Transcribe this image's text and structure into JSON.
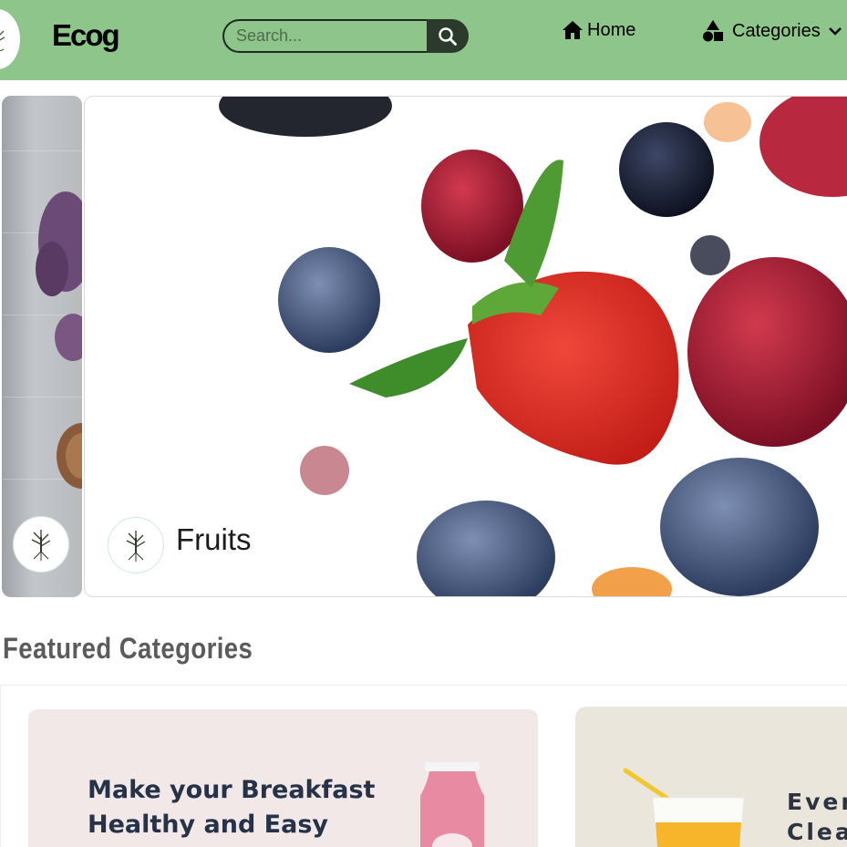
{
  "header": {
    "brand": "Ecog",
    "search": {
      "placeholder": "Search..."
    },
    "nav": {
      "home": "Home",
      "categories": "Categories"
    }
  },
  "hero": {
    "slides": [
      {
        "label": ""
      },
      {
        "label": "Fruits"
      }
    ]
  },
  "featured": {
    "title": "Featured Categories",
    "cards": [
      {
        "title": "Make your Breakfast Healthy and Easy"
      },
      {
        "title_line1": "Ever",
        "title_line2": "Clea"
      }
    ]
  },
  "colors": {
    "header_bg": "#8dc58a",
    "search_button": "#2b3a2b",
    "card1_bg": "#f2e8e8",
    "card2_bg": "#ebe6dc",
    "heading_text": "#5b5b5b"
  },
  "icons": [
    "tree-logo-icon",
    "search-icon",
    "home-icon",
    "shapes-icon",
    "chevron-down-icon"
  ]
}
